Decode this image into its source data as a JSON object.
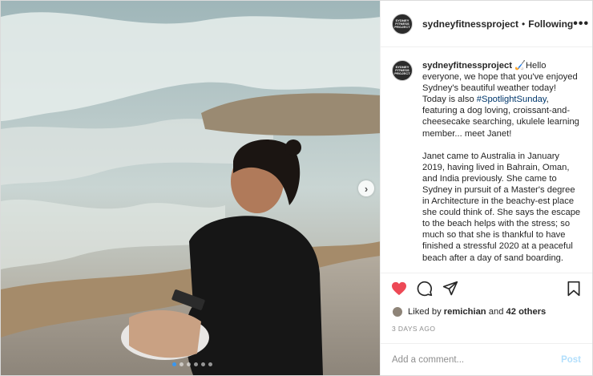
{
  "header": {
    "username": "sydneyfitnessproject",
    "separator": "•",
    "follow_label": "Following",
    "more_label": "•••"
  },
  "avatar": {
    "logo_text": "SYDNEY FITNESS PROJECT"
  },
  "caption": {
    "username": "sydneyfitnessproject",
    "emoji": "🏑",
    "text_before_tag": "Hello everyone, we hope that you've enjoyed Sydney's beautiful weather today! Today is also ",
    "hashtag": "#SpotlightSunday",
    "text_after_tag": ", featuring a dog loving, croissant-and-cheesecake searching, ukulele learning member... meet Janet!",
    "paragraph2": "Janet came to Australia in January 2019, having lived in Bahrain, Oman, and India previously. She came to Sydney in pursuit of a Master's degree in Architecture in the beachy-est place she could think of. She says the escape to the beach helps with the stress; so much so that she is thankful to have finished a stressful 2020 at a peaceful beach after a day of sand boarding."
  },
  "actions": {
    "like_icon": "heart-filled-icon",
    "comment_icon": "comment-bubble-icon",
    "share_icon": "paper-plane-icon",
    "save_icon": "bookmark-icon",
    "like_color": "#ed4956"
  },
  "likes": {
    "prefix": "Liked by",
    "user": "remichian",
    "conjunction": "and",
    "others": "42 others"
  },
  "post_date": "3 DAYS AGO",
  "comment": {
    "placeholder": "Add a comment...",
    "post_label": "Post"
  },
  "carousel": {
    "next_icon": "chevron-right-icon",
    "next_label": "›",
    "slide_count": 6,
    "active_index": 0
  }
}
